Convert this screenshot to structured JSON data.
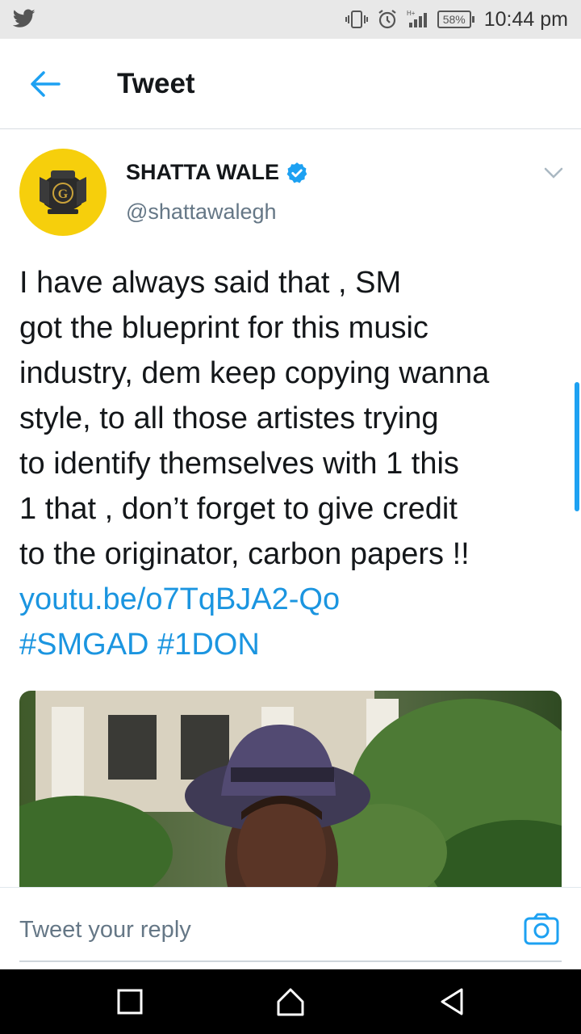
{
  "status_bar": {
    "app_icon": "twitter-bird-icon",
    "battery": "58%",
    "time": "10:44 pm"
  },
  "header": {
    "title": "Tweet",
    "back_icon": "back-arrow-icon"
  },
  "tweet": {
    "author_name": "SHATTA WALE",
    "handle": "@shattawalegh",
    "text_lines": [
      "I have always said that , SM",
      "got the blueprint for this music",
      "industry, dem keep copying wanna",
      "style, to all those artistes trying",
      "to identify themselves with 1 this",
      "1 that , don’t forget to give credit",
      "to the originator, carbon papers !!"
    ],
    "link": "youtu.be/o7TqBJA2-Qo",
    "hashtags": [
      "#SMGAD",
      "#1DON"
    ]
  },
  "reply": {
    "placeholder": "Tweet your reply",
    "camera_icon": "camera-icon"
  },
  "colors": {
    "accent": "#1da1f2",
    "link": "#1b95e0",
    "avatar_bg": "#f6cf0c"
  }
}
